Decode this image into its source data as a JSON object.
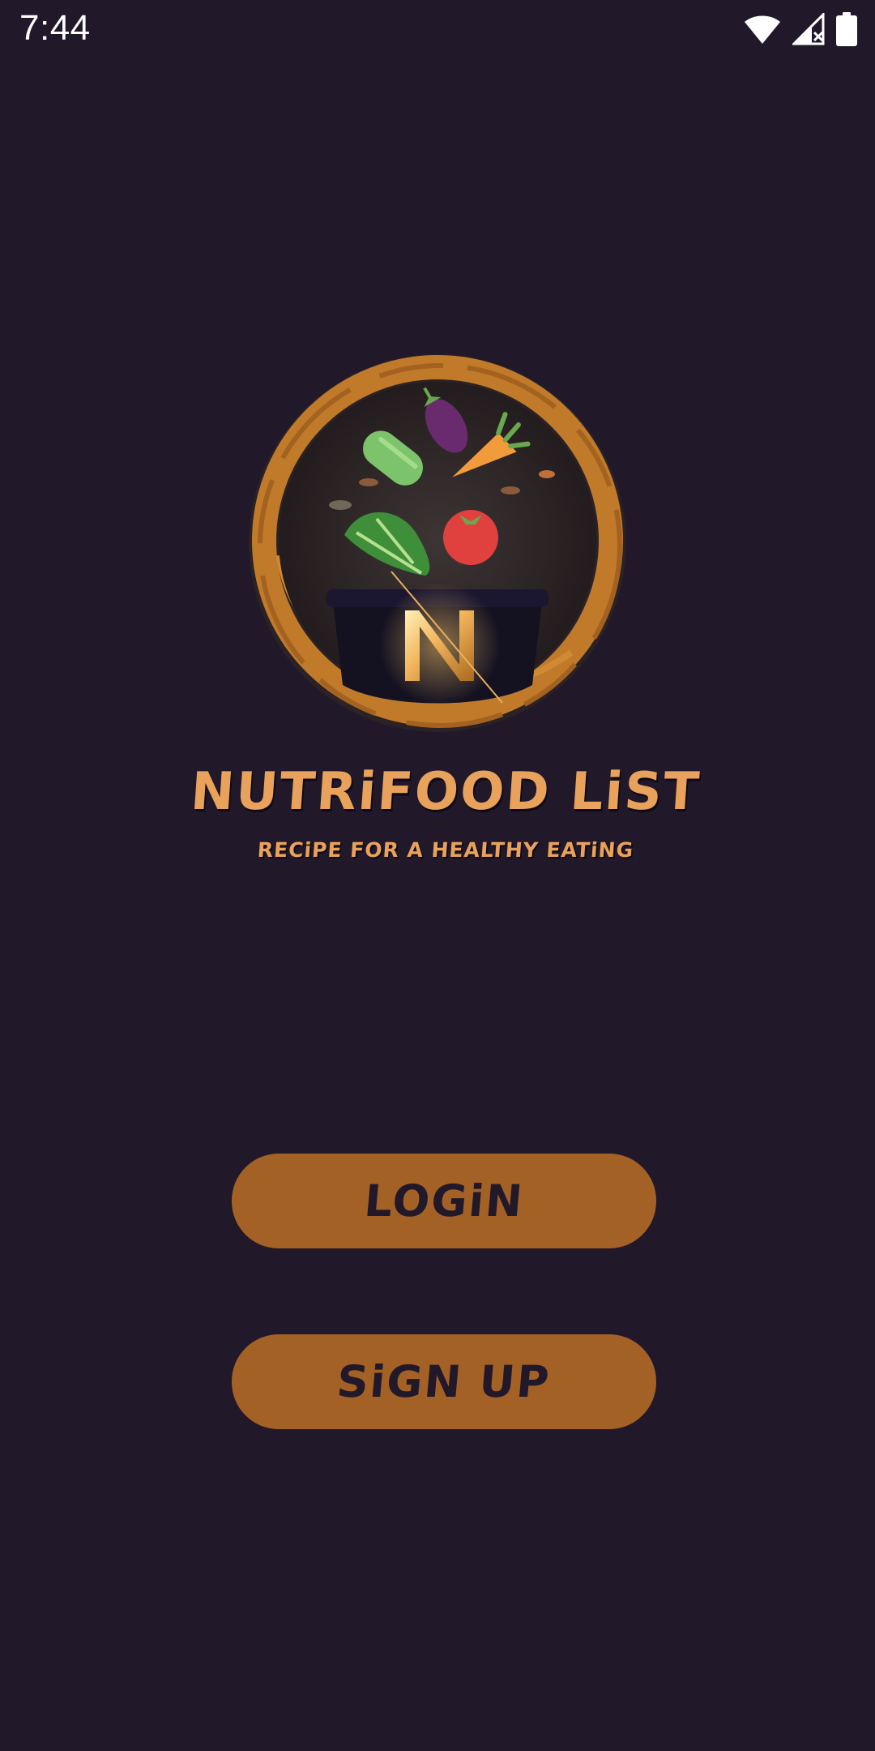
{
  "status_bar": {
    "time": "7:44",
    "icons": [
      "wifi-icon",
      "cellular-signal-icon",
      "battery-icon"
    ]
  },
  "logo": {
    "icon": "nutrifood-logo-icon",
    "letter": "N"
  },
  "app": {
    "title": "NUTRiFOOD LiST",
    "subtitle": "RECiPE FOR A HEALTHY EATiNG"
  },
  "buttons": {
    "login_label": "LOGiN",
    "signup_label": "SiGN UP"
  },
  "colors": {
    "background": "#21182a",
    "accent": "#a46126",
    "title": "#e9a25b"
  }
}
